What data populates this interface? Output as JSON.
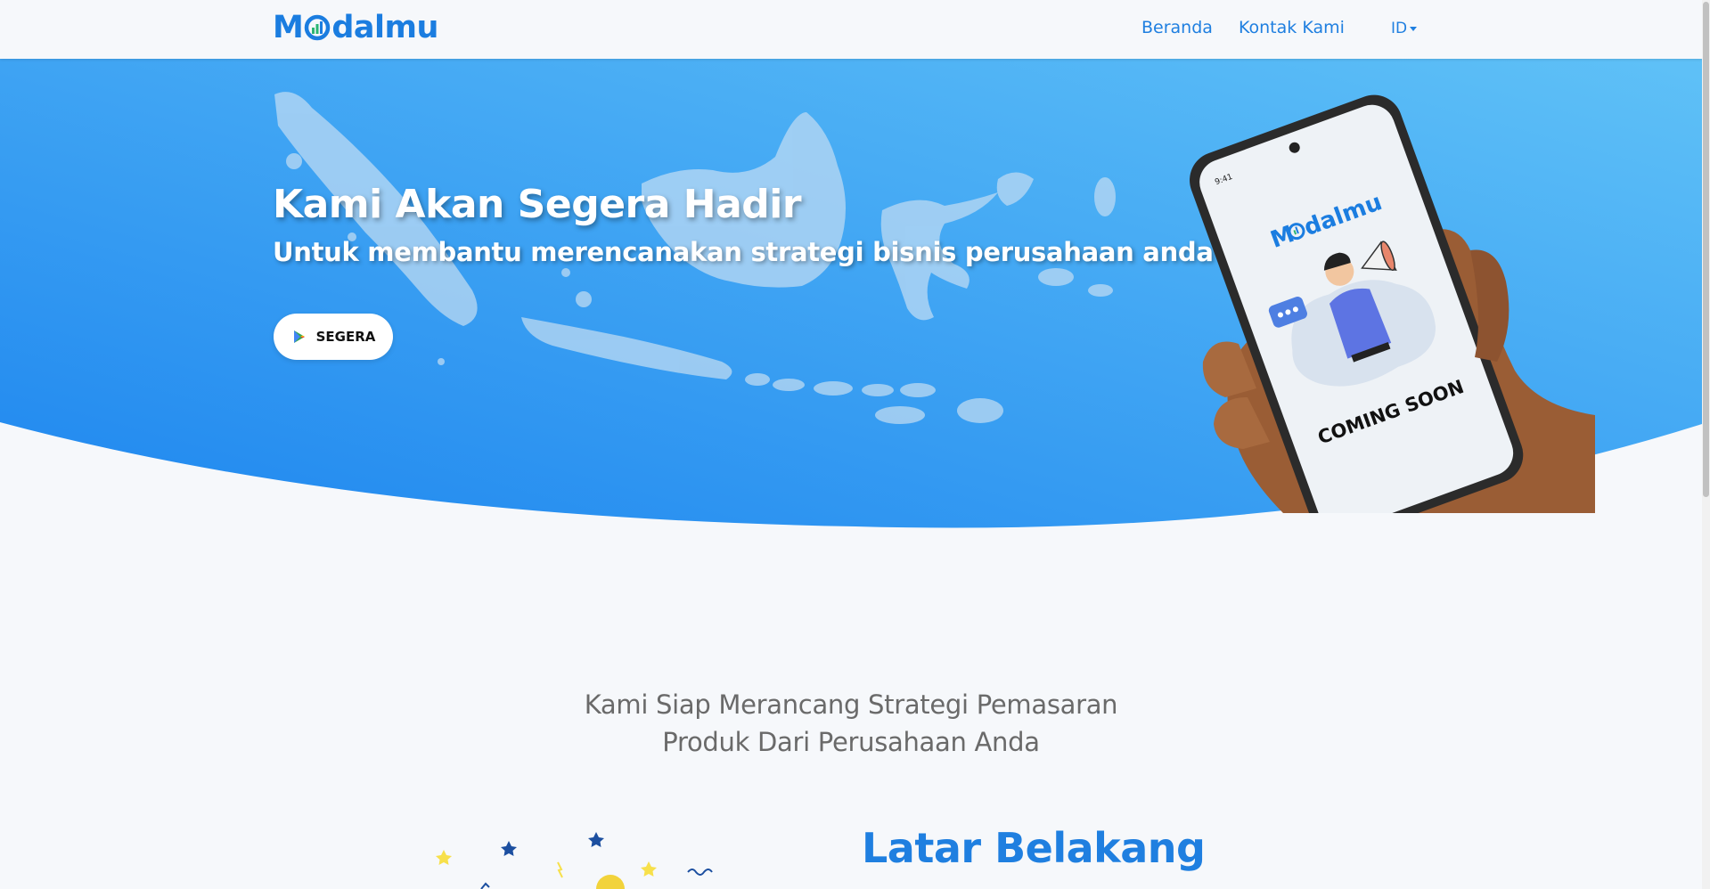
{
  "brand": {
    "logo_text_left": "M",
    "logo_text_right": "dalmu",
    "primary_color": "#1f7fe0",
    "hero_gradient": [
      "#1e86ef",
      "#5fc1f7"
    ]
  },
  "navbar": {
    "links": [
      {
        "label": "Beranda"
      },
      {
        "label": "Kontak Kami"
      }
    ],
    "language": "ID"
  },
  "hero": {
    "title": "Kami Akan Segera Hadir",
    "subtitle": "Untuk membantu merencanakan strategi bisnis perusahaan anda",
    "cta_label": "SEGERA",
    "cta_icon": "play-store-icon",
    "phone": {
      "status_time": "9:41",
      "logo_text_left": "M",
      "logo_text_right": "dalmu",
      "badge": "COMING SOON"
    }
  },
  "intro": {
    "line1": "Kami Siap Merancang Strategi Pemasaran",
    "line2": "Produk Dari Perusahaan Anda"
  },
  "background_section": {
    "title": "Latar Belakang"
  }
}
